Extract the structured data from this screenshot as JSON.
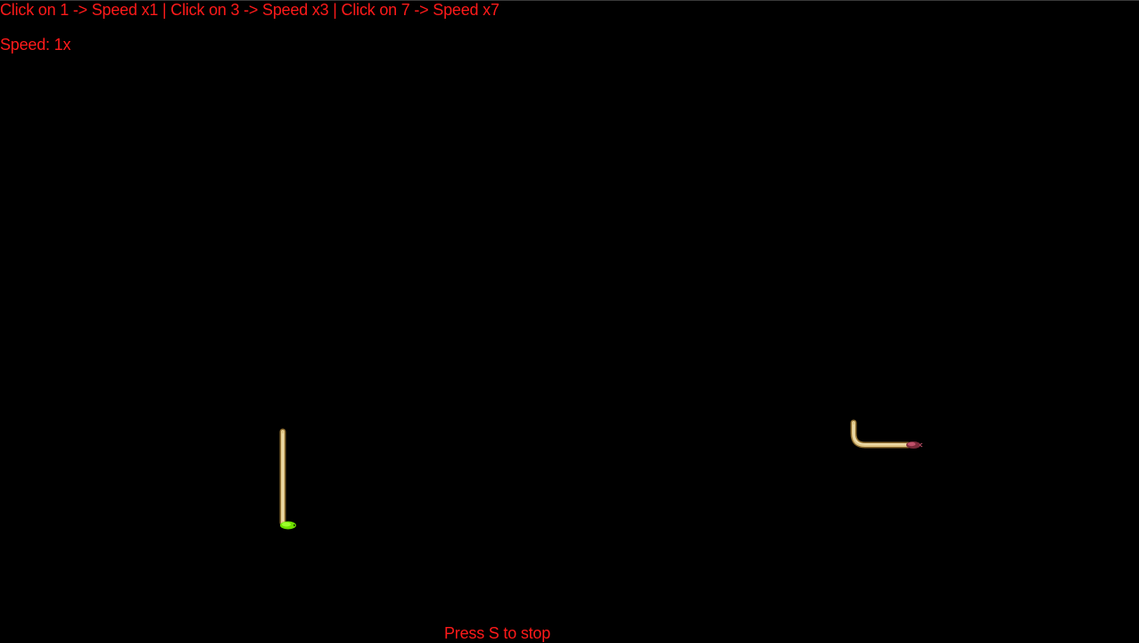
{
  "hud": {
    "instructions": "Click on 1 -> Speed x1 | Click on 3 -> Speed x3 | Click on 7 -> Speed x7",
    "speed_text": "Speed: 1x",
    "footer": "Press S to stop"
  },
  "colors": {
    "background": "#000000",
    "hud_text": "#ff1a1a",
    "snake_body": "#e2c98a",
    "snake_outline": "#8a6a2e",
    "player1_head": "#6fe000",
    "player2_head": "#c0506a"
  },
  "players": [
    {
      "id": "player-1",
      "head_icon": "green-snake-head-icon"
    },
    {
      "id": "player-2",
      "head_icon": "red-snake-head-icon"
    }
  ]
}
